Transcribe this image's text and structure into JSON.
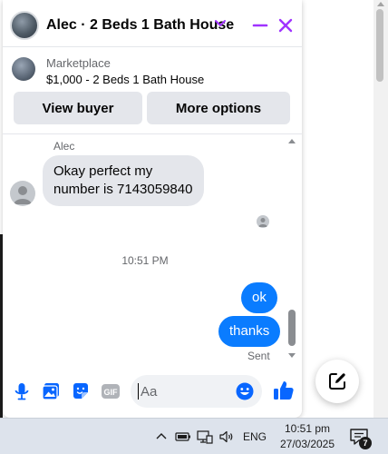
{
  "chat": {
    "title": "Alec · 2 Beds 1 Bath House",
    "accent_color": "#a033ff",
    "header_icons": [
      "chevron-down-icon",
      "minimize-icon",
      "close-icon"
    ]
  },
  "listing": {
    "source": "Marketplace",
    "title": "$1,000 - 2 Beds 1 Bath House",
    "view_buyer_label": "View buyer",
    "more_options_label": "More options"
  },
  "messages": {
    "sender": "Alec",
    "incoming": "Okay perfect my number is 7143059840",
    "timestamp": "10:51 PM",
    "outgoing": [
      "ok",
      "thanks"
    ],
    "status": "Sent",
    "outgoing_color": "#0a7cff"
  },
  "composer": {
    "placeholder": "Aa",
    "tools": [
      "microphone-icon",
      "gallery-icon",
      "sticker-icon",
      "gif-icon"
    ],
    "emoji_icon": "emoji-icon",
    "like_icon": "thumbs-up-icon",
    "tool_color": "#0866ff"
  },
  "taskbar": {
    "language": "ENG",
    "time": "10:51 pm",
    "date": "27/03/2025",
    "notification_count": "7"
  }
}
